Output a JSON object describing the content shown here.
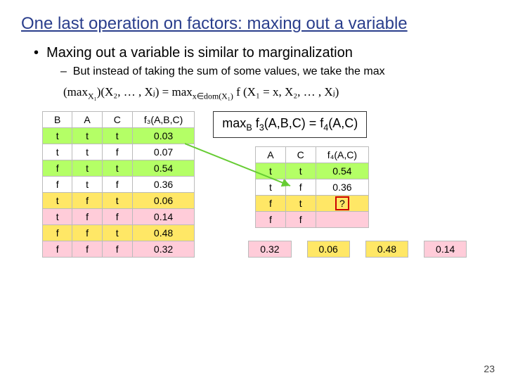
{
  "title": "One last operation on factors: maxing out a variable",
  "bullet1": "Maxing out a variable is similar to marginalization",
  "bullet2": "But instead of taking the sum of some values, we take the max",
  "formula_left": "max",
  "formula_sub1": "X₁",
  "formula_mid": "(X₂, … , Xⱼ) = max",
  "formula_sub2": "x∈dom(X₁)",
  "formula_right": " f (X₁ = x, X₂, … , Xⱼ)",
  "t1_headers": [
    "B",
    "A",
    "C",
    "f₃(A,B,C)"
  ],
  "t1_rows": [
    {
      "c": [
        "t",
        "t",
        "t",
        "0.03"
      ],
      "cls": "green"
    },
    {
      "c": [
        "t",
        "t",
        "f",
        "0.07"
      ],
      "cls": "white"
    },
    {
      "c": [
        "f",
        "t",
        "t",
        "0.54"
      ],
      "cls": "green"
    },
    {
      "c": [
        "f",
        "t",
        "f",
        "0.36"
      ],
      "cls": "white"
    },
    {
      "c": [
        "t",
        "f",
        "t",
        "0.06"
      ],
      "cls": "yellow"
    },
    {
      "c": [
        "t",
        "f",
        "f",
        "0.14"
      ],
      "cls": "pink"
    },
    {
      "c": [
        "f",
        "f",
        "t",
        "0.48"
      ],
      "cls": "yellow"
    },
    {
      "c": [
        "f",
        "f",
        "f",
        "0.32"
      ],
      "cls": "pink"
    }
  ],
  "maxbox": "maxB f₃(A,B,C) = f₄(A,C)",
  "t2_headers": [
    "A",
    "C",
    "f₄(A,C)"
  ],
  "t2_rows": [
    {
      "c": [
        "t",
        "t",
        "0.54"
      ],
      "cls": "green"
    },
    {
      "c": [
        "t",
        "f",
        "0.36"
      ],
      "cls": "white"
    },
    {
      "c": [
        "f",
        "t",
        "?"
      ],
      "cls": "yellow",
      "q": true
    },
    {
      "c": [
        "f",
        "f",
        ""
      ],
      "cls": "pink"
    }
  ],
  "choices": [
    {
      "v": "0.32",
      "cls": "pink"
    },
    {
      "v": "0.06",
      "cls": "yellow"
    },
    {
      "v": "0.48",
      "cls": "yellow"
    },
    {
      "v": "0.14",
      "cls": "pink"
    }
  ],
  "slidenum": "23"
}
